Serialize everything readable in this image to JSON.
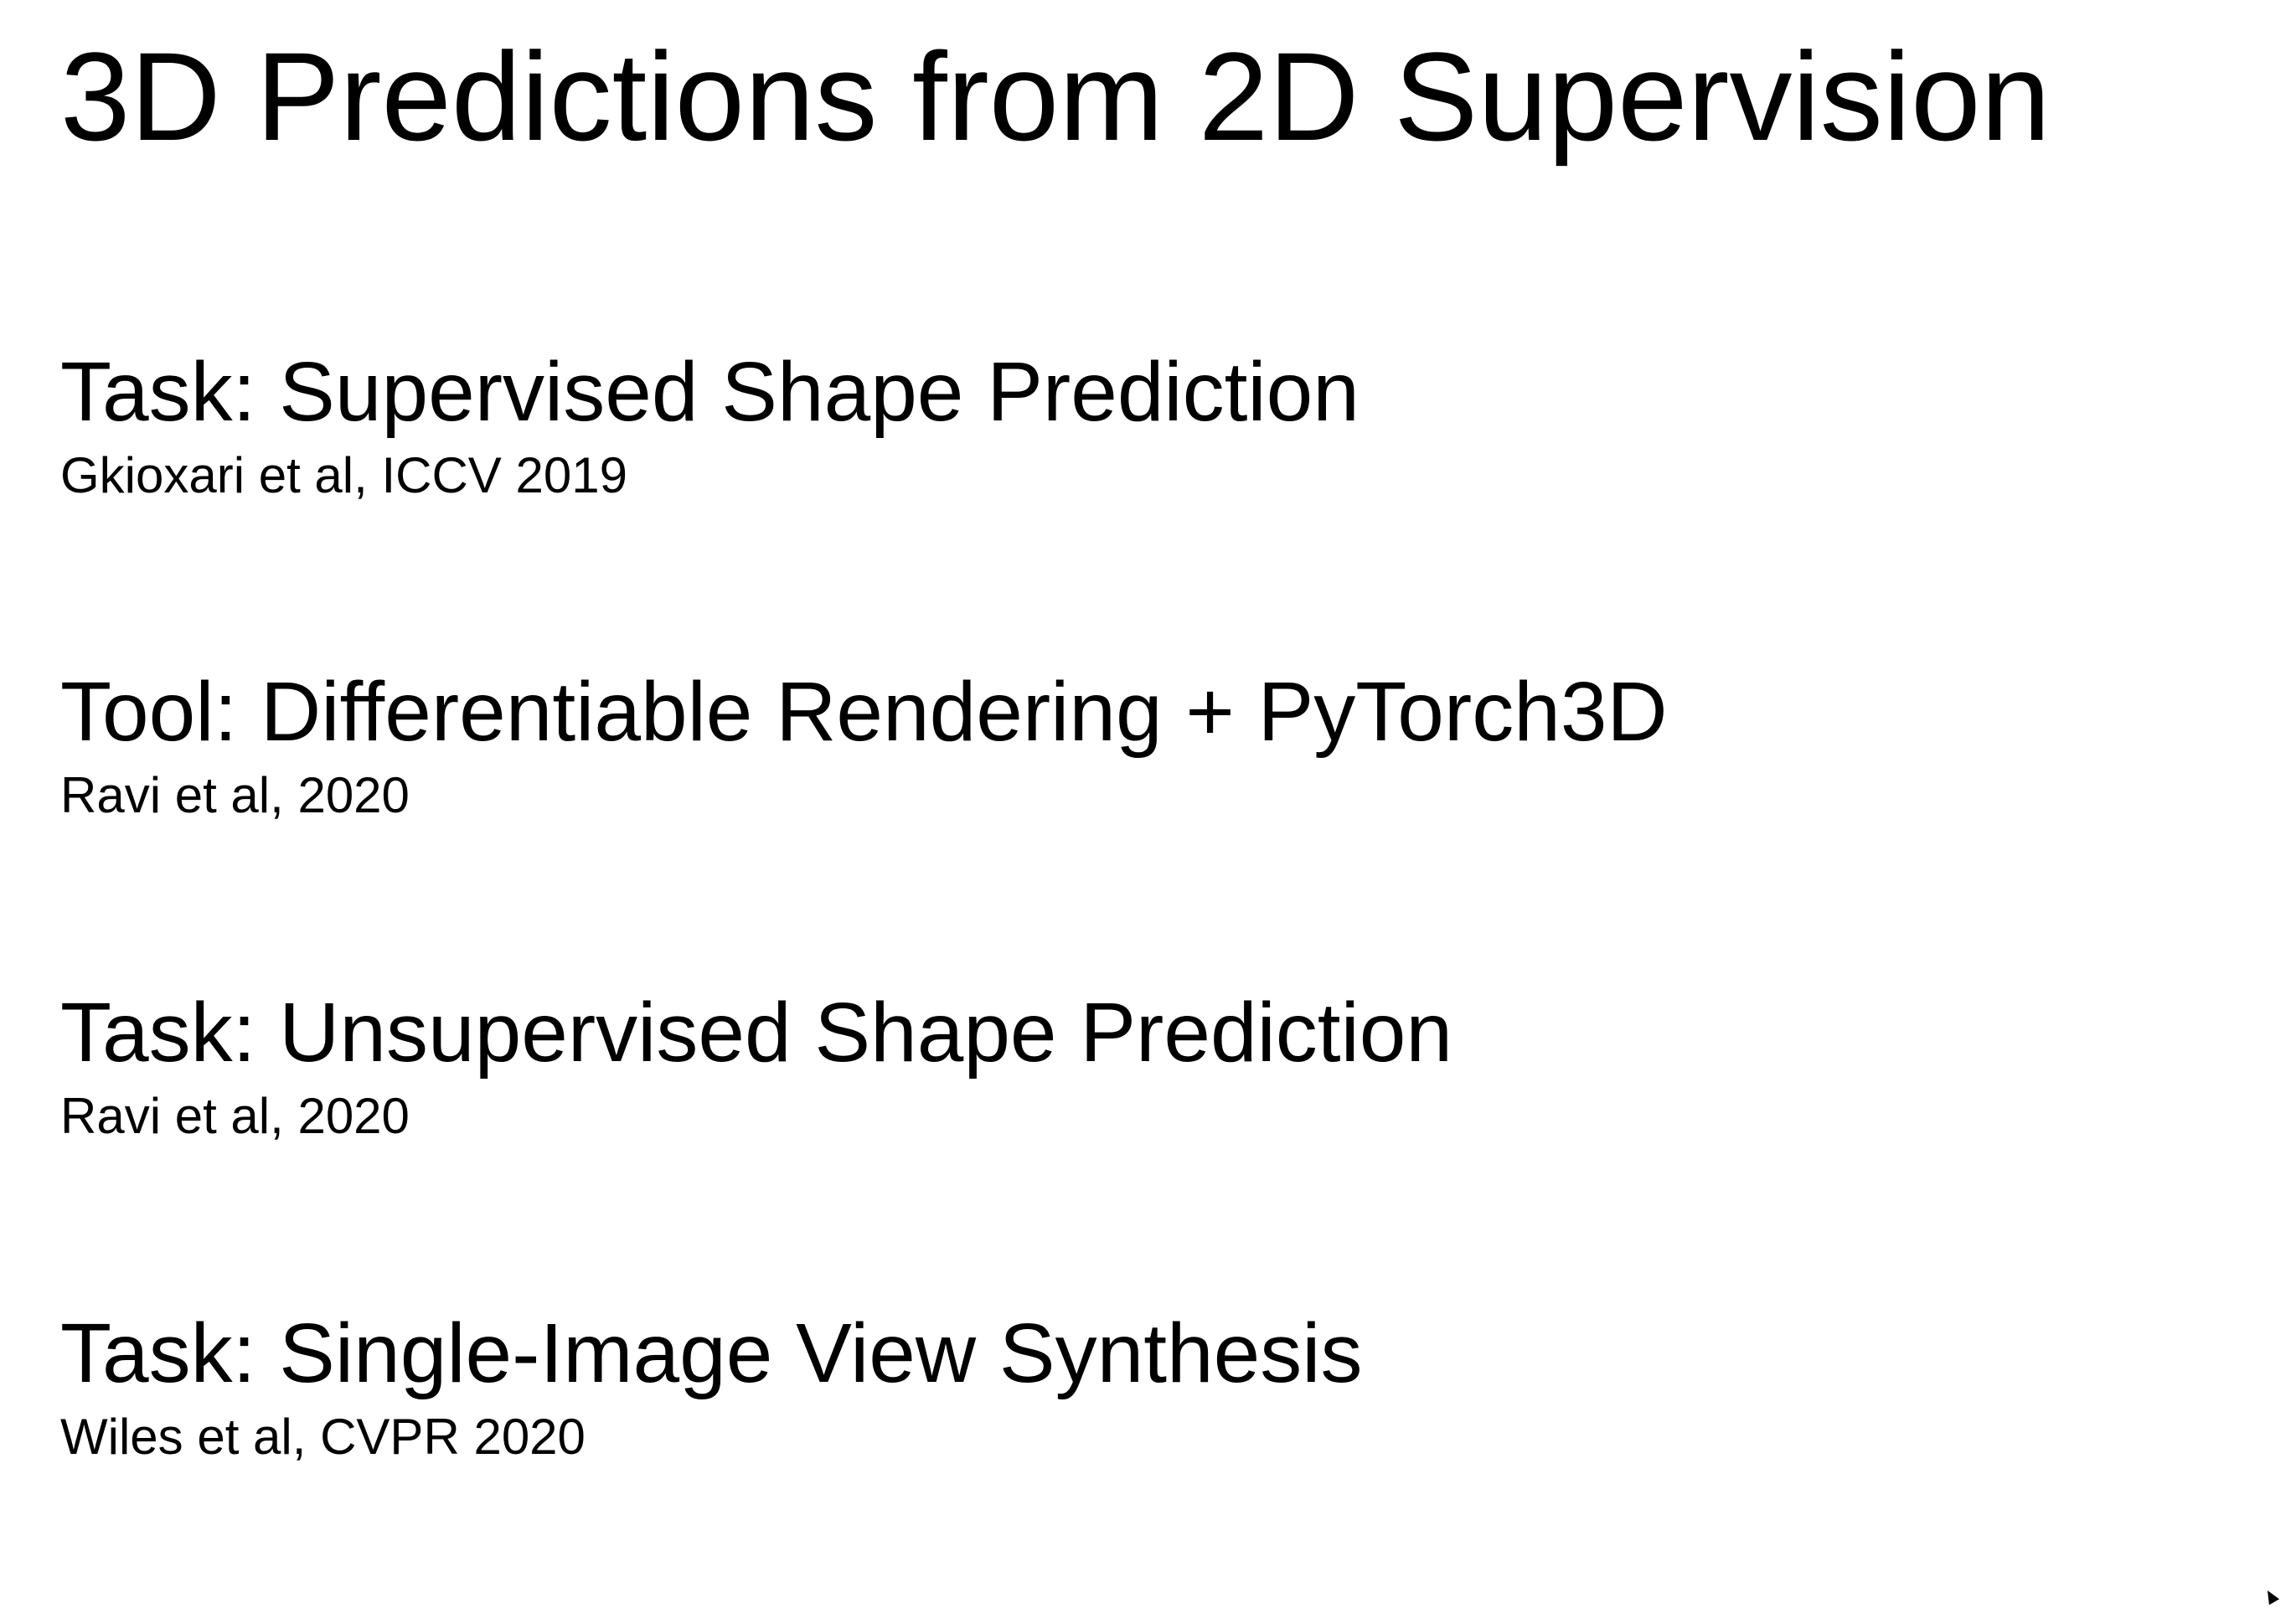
{
  "slide": {
    "title": "3D Predictions from 2D Supervision",
    "entries": [
      {
        "heading": "Task: Supervised Shape Prediction",
        "citation": "Gkioxari et al, ICCV 2019"
      },
      {
        "heading": "Tool: Differentiable Rendering + PyTorch3D",
        "citation": "Ravi et al, 2020"
      },
      {
        "heading": "Task: Unsupervised Shape Prediction",
        "citation": "Ravi et al, 2020"
      },
      {
        "heading": "Task: Single-Image View Synthesis",
        "citation": "Wiles et al, CVPR 2020"
      }
    ]
  },
  "icons": {
    "cursor": "mouse-pointer-icon"
  },
  "colors": {
    "background": "#ffffff",
    "text": "#000000"
  }
}
